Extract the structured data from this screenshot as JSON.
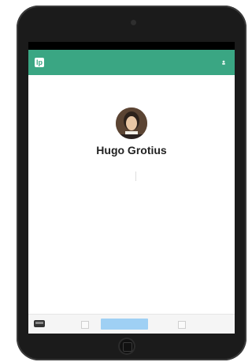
{
  "status_bar": {
    "left": "",
    "center": "",
    "right": ""
  },
  "app_bar": {
    "title": "",
    "account_label": "",
    "logo_glyph": "lp"
  },
  "profile": {
    "name": "Hugo Grotius",
    "subtitle": "",
    "stats": [
      {
        "label": ""
      },
      {
        "label": ""
      }
    ]
  },
  "details": {
    "section_title": "",
    "rows": [
      {
        "key": "",
        "value": ""
      },
      {
        "key": "",
        "value": ""
      },
      {
        "key": "",
        "value": ""
      },
      {
        "key": "",
        "value": ""
      },
      {
        "key": "",
        "value": ""
      },
      {
        "key": "",
        "value": ""
      },
      {
        "key": "",
        "value": ""
      },
      {
        "key": "",
        "value": ""
      },
      {
        "key": "",
        "value": ""
      },
      {
        "key": "",
        "value": ""
      },
      {
        "key": "",
        "value": ""
      }
    ]
  },
  "toolbar": {
    "left_box": "",
    "primary_label": "",
    "right_box": "",
    "link_label": ""
  },
  "colors": {
    "accent": "#3aa683",
    "primary_button": "#9fd0f4",
    "link": "#2b78d8"
  },
  "icons": {
    "logo": "lp-logo-icon",
    "avatar": "portrait-avatar",
    "tray": "inbox-tray-icon"
  }
}
